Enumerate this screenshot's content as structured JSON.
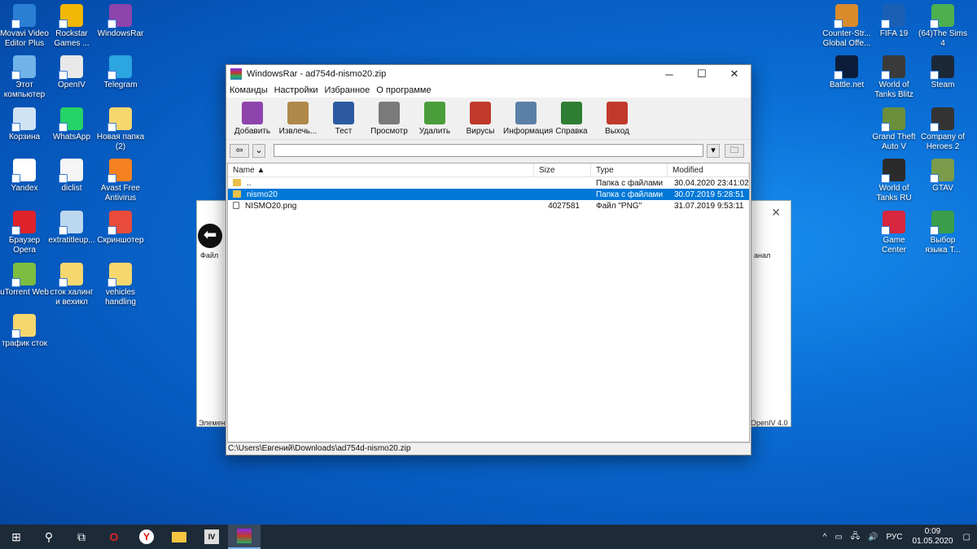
{
  "desktop_left": [
    {
      "label": "Movavi Video Editor Plus",
      "color": "#2a7fd4"
    },
    {
      "label": "Rockstar Games ...",
      "color": "#f2b705"
    },
    {
      "label": "WindowsRar",
      "color": "#8e44ad"
    },
    {
      "label": "Этот компьютер",
      "color": "#6fb3e8"
    },
    {
      "label": "OpenIV",
      "color": "#e8e8e8"
    },
    {
      "label": "Telegram",
      "color": "#2ca5e0"
    },
    {
      "label": "Корзина",
      "color": "#cfe3f5"
    },
    {
      "label": "WhatsApp",
      "color": "#25d366"
    },
    {
      "label": "Новая папка (2)",
      "color": "#f5d76e"
    },
    {
      "label": "Yandex",
      "color": "#ffffff"
    },
    {
      "label": "diclist",
      "color": "#f5f5f5"
    },
    {
      "label": "Avast Free Antivirus",
      "color": "#f58220"
    },
    {
      "label": "Браузер Opera",
      "color": "#e0222a"
    },
    {
      "label": "extratitleup...",
      "color": "#bcd8f0"
    },
    {
      "label": "Скриншотер",
      "color": "#e94b3c"
    },
    {
      "label": "uTorrent Web",
      "color": "#7cbd42"
    },
    {
      "label": "сток халинг и вехикл",
      "color": "#f5d76e"
    },
    {
      "label": "vehicles handling",
      "color": "#f5d76e"
    },
    {
      "label": "трафик сток",
      "color": "#f5d76e"
    }
  ],
  "desktop_right": [
    {
      "label": "Counter-Str... Global Offe...",
      "color": "#d98b2b"
    },
    {
      "label": "FIFA 19",
      "color": "#1b5fb5"
    },
    {
      "label": "(64)The Sims 4",
      "color": "#4caf50"
    },
    {
      "label": "Battle.net",
      "color": "#0b1d3a"
    },
    {
      "label": "World of Tanks Blitz",
      "color": "#3a3a3a"
    },
    {
      "label": "Steam",
      "color": "#1b2838"
    },
    {
      "label": "Grand Theft Auto V",
      "color": "#6a8f3c"
    },
    {
      "label": "Company of Heroes 2",
      "color": "#333333"
    },
    {
      "label": "World of Tanks RU",
      "color": "#2b2b2b"
    },
    {
      "label": "GTAV",
      "color": "#7a9c4a"
    },
    {
      "label": "Game Center",
      "color": "#d7263d"
    },
    {
      "label": "Выбор языка T...",
      "color": "#3a9d4a"
    }
  ],
  "back_window": {
    "texts": [
      "Файл",
      "Элемент",
      "анал",
      "OpenIV 4.0"
    ]
  },
  "winrar": {
    "title": "WindowsRar - ad754d-nismo20.zip",
    "menu": [
      "Команды",
      "Настройки",
      "Избранное",
      "О программе"
    ],
    "toolbar": [
      {
        "label": "Добавить",
        "color": "#8e44ad"
      },
      {
        "label": "Извлечь...",
        "color": "#b0884a"
      },
      {
        "label": "Тест",
        "color": "#2c5aa0"
      },
      {
        "label": "Просмотр",
        "color": "#7a7a7a"
      },
      {
        "label": "Удалить",
        "color": "#4a9d3a"
      },
      {
        "label": "Вирусы",
        "color": "#c0392b"
      },
      {
        "label": "Информация",
        "color": "#5a7fa8"
      },
      {
        "label": "Справка",
        "color": "#2e7d32"
      },
      {
        "label": "Выход",
        "color": "#c0392b"
      }
    ],
    "columns": {
      "name": "Name",
      "size": "Size",
      "type": "Type",
      "modified": "Modified"
    },
    "rows": [
      {
        "name": "..",
        "size": "",
        "type": "Папка с файлами",
        "modified": "30.04.2020 23:41:02",
        "kind": "folder",
        "selected": false
      },
      {
        "name": "nismo20",
        "size": "",
        "type": "Папка с файлами",
        "modified": "30.07.2019 5:28:51",
        "kind": "folder",
        "selected": true
      },
      {
        "name": "NISMO20.png",
        "size": "4027581",
        "type": "Файл \"PNG\"",
        "modified": "31.07.2019 9:53:11",
        "kind": "png",
        "selected": false
      }
    ],
    "status": "C:\\Users\\Евгений\\Downloads\\ad754d-nismo20.zip"
  },
  "taskbar": {
    "lang": "РУС",
    "time": "0:09",
    "date": "01.05.2020"
  }
}
